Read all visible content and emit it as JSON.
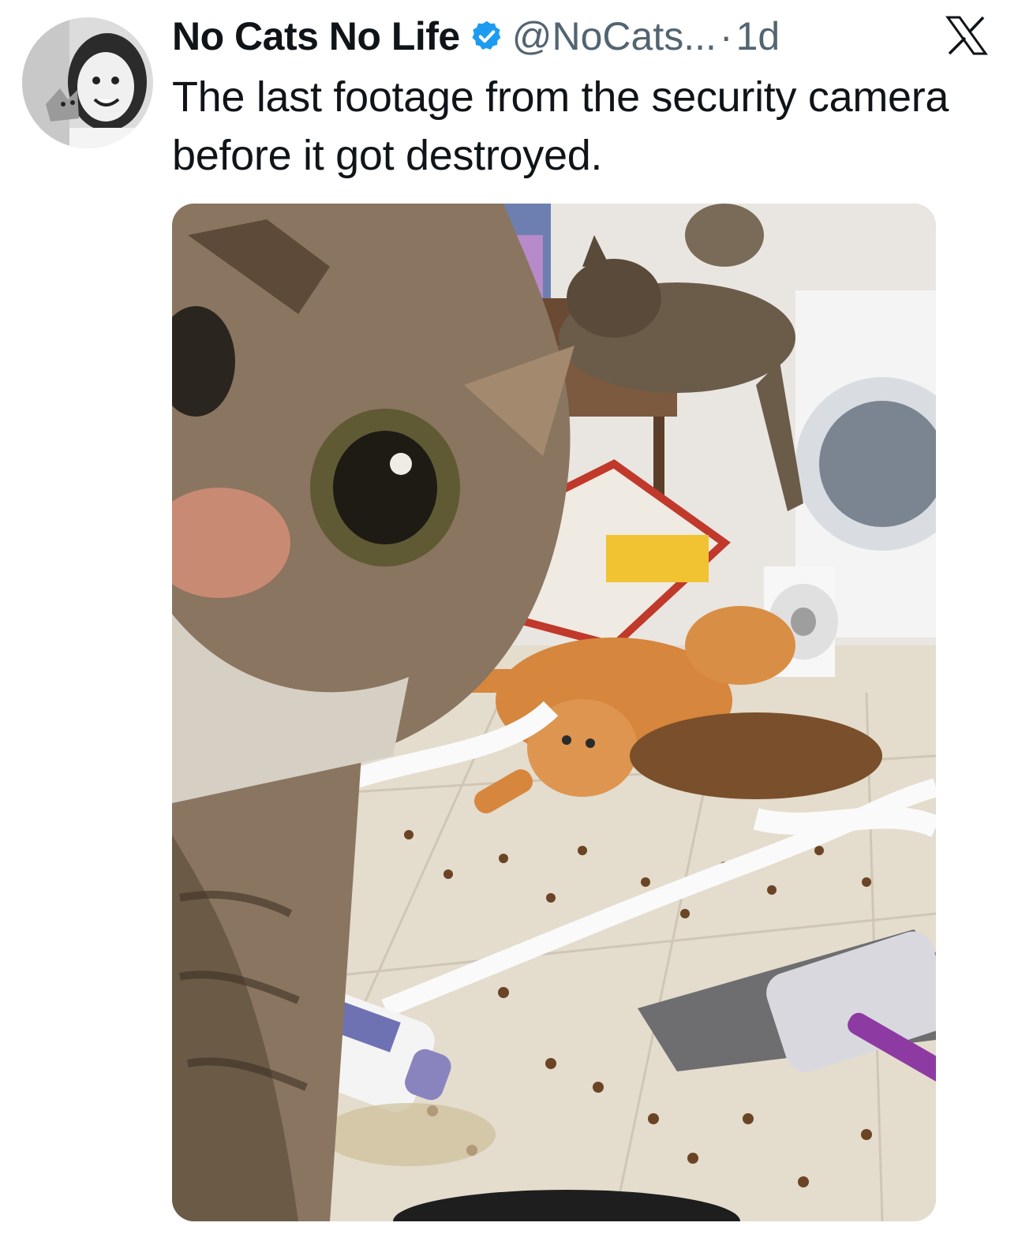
{
  "tweet": {
    "author_name": "No Cats No Life",
    "handle": "@NoCats...",
    "separator": "·",
    "time": "1d",
    "text": "The last footage from the security camera before it got destroyed.",
    "verified": true,
    "avatar_icon": "profile-photo-girl-with-kitten",
    "media_description_icon": "cats-messy-kitchen-photo"
  },
  "brand": {
    "logo_icon": "x-logo",
    "verified_color": "#1d9bf0"
  }
}
